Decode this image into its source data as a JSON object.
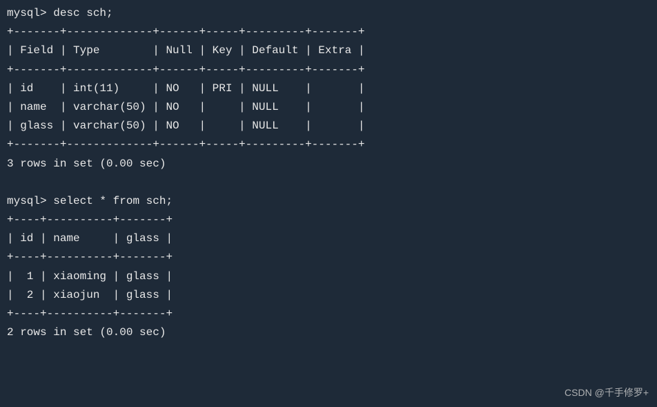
{
  "prompt": "mysql>",
  "query1": {
    "command": "desc sch;",
    "sep": "+-------+-------------+------+-----+---------+-------+",
    "header": "| Field | Type        | Null | Key | Default | Extra |",
    "rows": [
      "| id    | int(11)     | NO   | PRI | NULL    |       |",
      "| name  | varchar(50) | NO   |     | NULL    |       |",
      "| glass | varchar(50) | NO   |     | NULL    |       |"
    ],
    "footer": "3 rows in set (0.00 sec)"
  },
  "query2": {
    "command": "select * from sch;",
    "sep": "+----+----------+-------+",
    "header": "| id | name     | glass |",
    "rows": [
      "|  1 | xiaoming | glass |",
      "|  2 | xiaojun  | glass |"
    ],
    "footer": "2 rows in set (0.00 sec)"
  },
  "watermark": "CSDN @千手修罗+",
  "chart_data": [
    {
      "type": "table",
      "title": "desc sch",
      "columns": [
        "Field",
        "Type",
        "Null",
        "Key",
        "Default",
        "Extra"
      ],
      "rows": [
        [
          "id",
          "int(11)",
          "NO",
          "PRI",
          "NULL",
          ""
        ],
        [
          "name",
          "varchar(50)",
          "NO",
          "",
          "NULL",
          ""
        ],
        [
          "glass",
          "varchar(50)",
          "NO",
          "",
          "NULL",
          ""
        ]
      ],
      "footer": "3 rows in set (0.00 sec)"
    },
    {
      "type": "table",
      "title": "select * from sch",
      "columns": [
        "id",
        "name",
        "glass"
      ],
      "rows": [
        [
          1,
          "xiaoming",
          "glass"
        ],
        [
          2,
          "xiaojun",
          "glass"
        ]
      ],
      "footer": "2 rows in set (0.00 sec)"
    }
  ]
}
